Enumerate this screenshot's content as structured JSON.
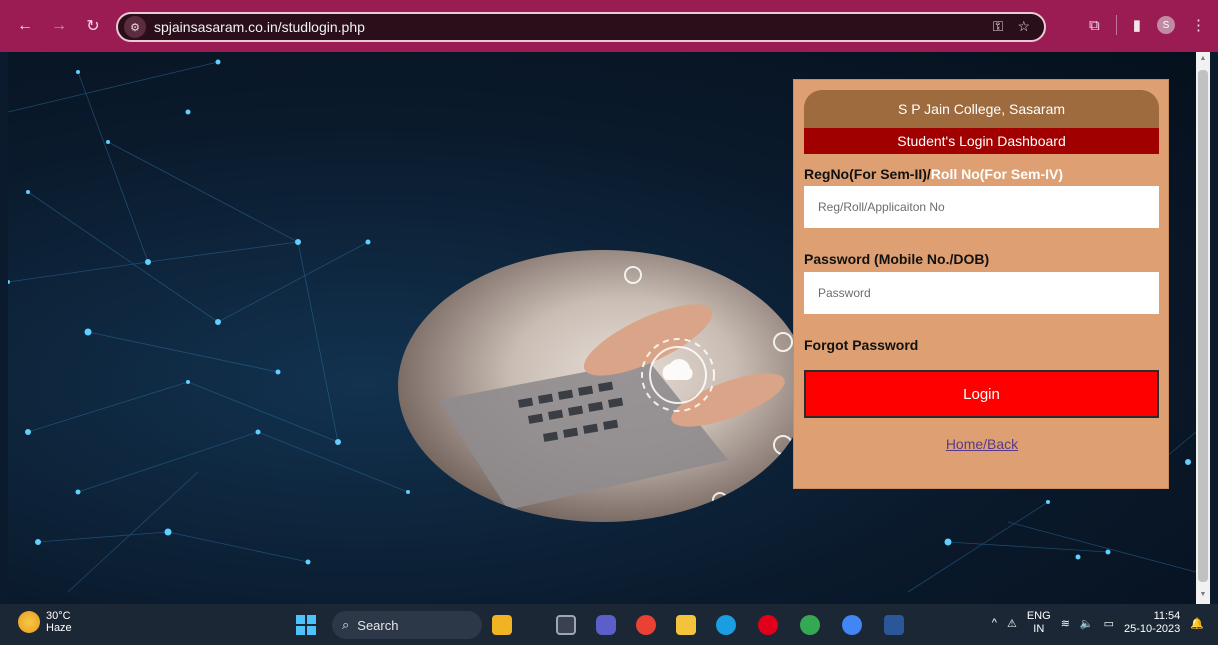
{
  "browser": {
    "url": "spjainsasaram.co.in/studlogin.php",
    "profile_initial": "S"
  },
  "login": {
    "college_name": "S P Jain College, Sasaram",
    "dashboard_title": "Student's Login Dashboard",
    "reg_label_part1": "RegNo(For Sem-II)/",
    "reg_label_part2": "Roll No(For Sem-IV)",
    "reg_placeholder": "Reg/Roll/Applicaiton No",
    "password_label": "Password (Mobile No./DOB)",
    "password_placeholder": "Password",
    "forgot_password": "Forgot Password",
    "login_button": "Login",
    "home_link": "Home/Back"
  },
  "taskbar": {
    "temperature": "30°C",
    "weather": "Haze",
    "search_label": "Search",
    "lang_line1": "ENG",
    "lang_line2": "IN",
    "time": "11:54",
    "date": "25-10-2023"
  },
  "colors": {
    "chrome": "#9a1c52",
    "panel": "#dea072",
    "college_header": "#9d6b3d",
    "dashboard_header": "#a00000",
    "login_button": "#ff0000"
  }
}
